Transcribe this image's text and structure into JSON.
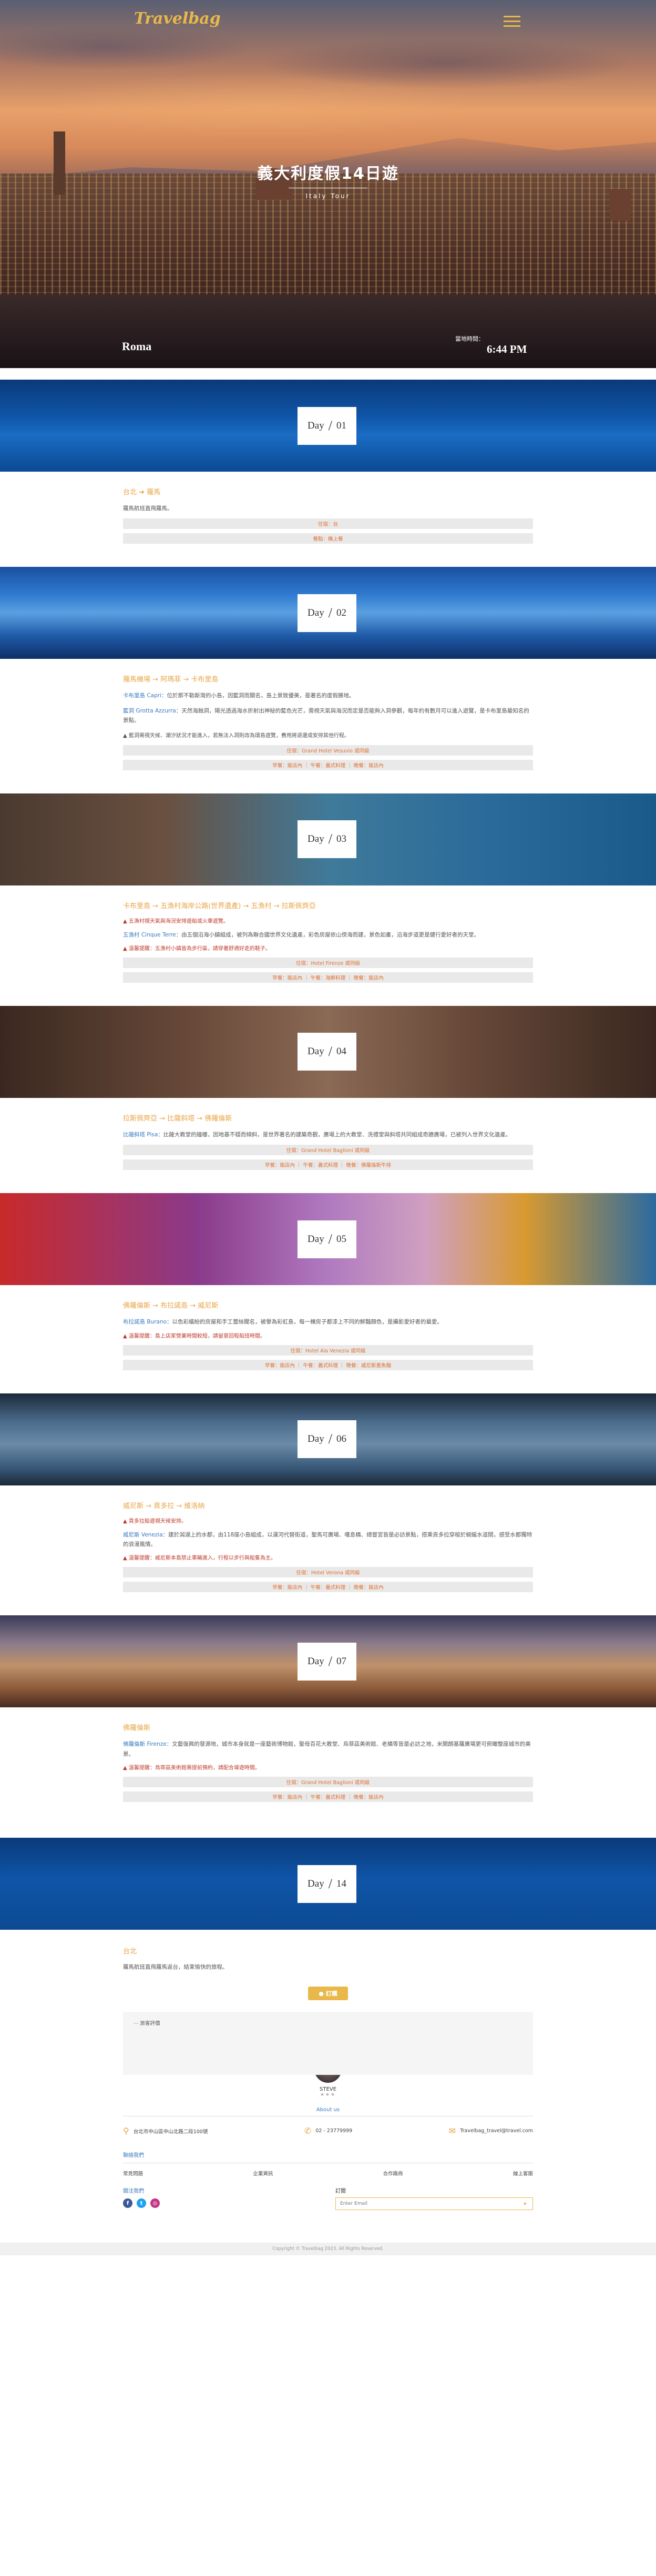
{
  "header": {
    "logo": "Travelbag"
  },
  "hero": {
    "title": "義大利度假14日遊",
    "subtitle": "Italy Tour",
    "city": "Roma",
    "time_label": "當地時間：",
    "time": "6:44 PM"
  },
  "days": [
    {
      "day_label": "Day",
      "day_num": "01",
      "route": [
        "台北",
        "羅馬"
      ],
      "description": "羅馬航班直飛羅馬。",
      "bars": [
        "住宿：台",
        "餐點：機上餐"
      ]
    },
    {
      "day_label": "Day",
      "day_num": "02",
      "route": [
        "羅馬機場",
        "阿瑪菲",
        "卡布里島"
      ],
      "description_parts": [
        {
          "hl": "卡布里島 Capri：",
          "text": "位於那不勒斯灣的小島，因藍洞而聞名，島上景致優美，是著名的度假勝地。"
        },
        {
          "hl": "藍洞 Grotta Azzurra：",
          "text": "天然海蝕洞，陽光透過海水折射出神秘的藍色光芒，需視天氣與海況而定是否能夠入洞參觀，每年約有數月可以進入遊覽，是卡布里島最知名的景點。"
        }
      ],
      "note": "▲ 藍洞需視天候、潮汐狀況才能進入，若無法入洞則改為環島遊覽，費用將退還或安排其他行程。",
      "bars": [
        "住宿：Grand Hotel Vesuvio 或同級",
        "早餐：飯店內 ｜ 午餐：義式料理 ｜ 晚餐：飯店內"
      ]
    },
    {
      "day_label": "Day",
      "day_num": "03",
      "route": [
        "卡布里島",
        "五漁村海岸公路(世界遺產)",
        "五漁村",
        "拉斯佩齊亞"
      ],
      "warn_top": "▲ 五漁村視天氣與海況安排遊船或火車遊覽。",
      "description_parts": [
        {
          "hl": "五漁村 Cinque Terre：",
          "text": "由五個沿海小鎮組成，被列為聯合國世界文化遺產，彩色房屋依山傍海而建，景色如畫，沿海步道更是健行愛好者的天堂。"
        }
      ],
      "warn": "▲ 溫馨提醒：五漁村小鎮皆為步行區，請穿著舒適好走的鞋子。",
      "bars": [
        "住宿：Hotel Firenze 或同級",
        "早餐：飯店內 ｜ 午餐：海鮮料理 ｜ 晚餐：飯店內"
      ]
    },
    {
      "day_label": "Day",
      "day_num": "04",
      "route": [
        "拉斯佩齊亞",
        "比薩斜塔",
        "佛羅倫斯"
      ],
      "description_parts": [
        {
          "hl": "比薩斜塔 Pisa：",
          "text": "比薩大教堂的鐘樓，因地基不穩而傾斜，是世界著名的建築奇觀，廣場上的大教堂、洗禮堂與斜塔共同組成奇蹟廣場，已被列入世界文化遺產。"
        }
      ],
      "bars": [
        "住宿：Grand Hotel Baglioni 或同級",
        "早餐：飯店內 ｜ 午餐：義式料理 ｜ 晚餐：佛羅倫斯牛排"
      ]
    },
    {
      "day_label": "Day",
      "day_num": "05",
      "route": [
        "佛羅倫斯",
        "布拉諾島",
        "威尼斯"
      ],
      "description_parts": [
        {
          "hl": "布拉諾島 Burano：",
          "text": "以色彩繽紛的房屋和手工蕾絲聞名，被譽為彩虹島，每一棟房子都漆上不同的鮮豔顏色，是攝影愛好者的最愛。"
        }
      ],
      "warn": "▲ 溫馨提醒：島上店家營業時間較短，請留意回程船班時間。",
      "bars": [
        "住宿：Hotel Ala Venezia 或同級",
        "早餐：飯店內 ｜ 午餐：義式料理 ｜ 晚餐：威尼斯墨魚麵"
      ]
    },
    {
      "day_label": "Day",
      "day_num": "06",
      "route": [
        "威尼斯",
        "貢多拉",
        "維洛納"
      ],
      "warn_top": "▲ 貢多拉船遊視天候安排。",
      "description_parts": [
        {
          "hl": "威尼斯 Venezia：",
          "text": "建於潟湖上的水都，由118座小島組成，以運河代替街道，聖馬可廣場、嘆息橋、總督宮皆是必訪景點，搭乘貢多拉穿梭於蜿蜒水道間，感受水都獨特的浪漫風情。"
        }
      ],
      "warn": "▲ 溫馨提醒：威尼斯本島禁止車輛進入，行程以步行與船隻為主。",
      "bars": [
        "住宿：Hotel Verona 或同級",
        "早餐：飯店內 ｜ 午餐：義式料理 ｜ 晚餐：飯店內"
      ]
    },
    {
      "day_label": "Day",
      "day_num": "07",
      "route": [
        "佛羅倫斯"
      ],
      "description_parts": [
        {
          "hl": "佛羅倫斯 Firenze：",
          "text": "文藝復興的發源地，城市本身就是一座藝術博物館，聖母百花大教堂、烏菲茲美術館、老橋等皆是必訪之地，米開朗基羅廣場更可俯瞰整座城市的美景。"
        }
      ],
      "warn": "▲ 溫馨提醒：烏菲茲美術館需提前預約，請配合導遊時間。",
      "bars": [
        "住宿：Grand Hotel Baglioni 或同級",
        "早餐：飯店內 ｜ 午餐：義式料理 ｜ 晚餐：飯店內"
      ]
    },
    {
      "day_label": "Day",
      "day_num": "14"
    }
  ],
  "closing": {
    "title": "台北",
    "text": "羅馬航班直飛羅馬返台，結束愉快的旅程。",
    "button": "訂購"
  },
  "comment": {
    "header": "旅客評價",
    "author": "STEVE",
    "stars": "★★★"
  },
  "about": {
    "title": "About us",
    "address": "台北市中山區中山北路二段100號",
    "phone": "02 - 23779999",
    "email": "Travelbag_travel@travel.com"
  },
  "footer": {
    "title": "聯絡我們",
    "links": [
      "常見問題",
      "企業資訊",
      "合作廠商",
      "線上客服"
    ],
    "follow": "關注我們",
    "subscribe_label": "訂閱",
    "subscribe_placeholder": "Enter Email",
    "copyright": "Copyright © Travelbag 2023. All Rights Reserved."
  },
  "colors": {
    "accent": "#e9b84a",
    "route": "#e9a545",
    "link": "#3a7ac0",
    "warn": "#c0392b"
  }
}
